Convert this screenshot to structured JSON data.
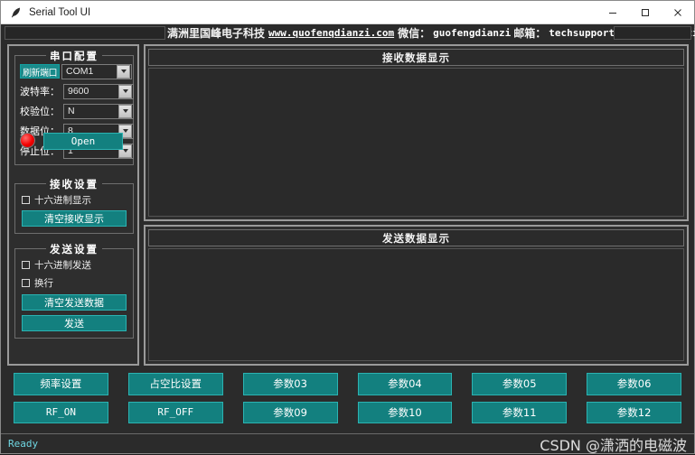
{
  "window": {
    "title": "Serial Tool UI",
    "icon": "feather-pen-icon",
    "minimize": "–",
    "maximize": "□",
    "close": "×"
  },
  "banner": {
    "company": "满洲里国峰电子科技",
    "website": "www.quofenqdianzi.com",
    "wechat_label": "微信：",
    "wechat_value": "guofengdianzi",
    "email_label": "邮箱：",
    "email_value": "techsupport@guofengdianzi.com"
  },
  "serial_config": {
    "group_title": "串口配置",
    "refresh_button": "刷新端口",
    "rows": [
      {
        "label": "",
        "value": "COM1"
      },
      {
        "label": "波特率：",
        "value": "9600"
      },
      {
        "label": "校验位：",
        "value": "N"
      },
      {
        "label": "数据位：",
        "value": "8"
      },
      {
        "label": "停止位：",
        "value": "1"
      }
    ],
    "led_state": "closed",
    "led_color": "#f40000",
    "open_button": "Open"
  },
  "receive_settings": {
    "group_title": "接收设置",
    "hex_display_label": "十六进制显示",
    "hex_display_checked": false,
    "clear_button": "清空接收显示"
  },
  "send_settings": {
    "group_title": "发送设置",
    "hex_send_label": "十六进制发送",
    "hex_send_checked": false,
    "newline_label": "换行",
    "newline_checked": false,
    "clear_button": "清空发送数据",
    "send_button": "发送"
  },
  "displays": {
    "receive_title": "接收数据显示",
    "receive_content": "",
    "send_title": "发送数据显示",
    "send_content": ""
  },
  "command_buttons": [
    {
      "label": "频率设置",
      "mono": false
    },
    {
      "label": "占空比设置",
      "mono": false
    },
    {
      "label": "参数03",
      "mono": false
    },
    {
      "label": "参数04",
      "mono": false
    },
    {
      "label": "参数05",
      "mono": false
    },
    {
      "label": "参数06",
      "mono": false
    },
    {
      "label": "RF_ON",
      "mono": true
    },
    {
      "label": "RF_OFF",
      "mono": true
    },
    {
      "label": "参数09",
      "mono": false
    },
    {
      "label": "参数10",
      "mono": false
    },
    {
      "label": "参数11",
      "mono": false
    },
    {
      "label": "参数12",
      "mono": false
    }
  ],
  "statusbar": {
    "status": "Ready",
    "watermark": "CSDN @潇洒的电磁波"
  },
  "theme": {
    "accent_teal": "#13807f",
    "accent_teal_border": "#2bb3b2",
    "background": "#2b2b2b",
    "panel_border": "#9a9a9a",
    "status_cyan": "#6fd6e2"
  }
}
